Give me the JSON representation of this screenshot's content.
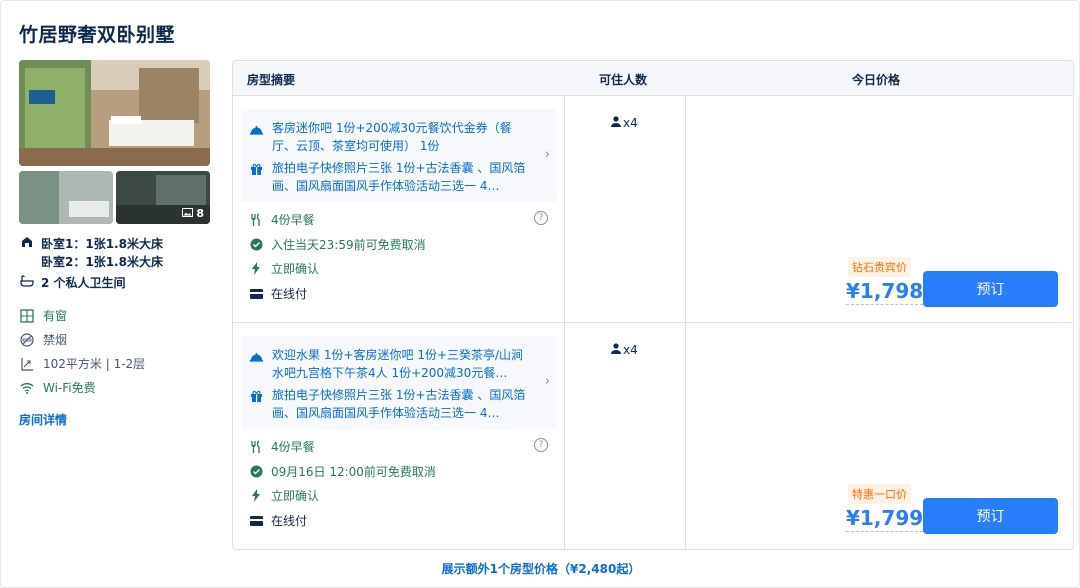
{
  "title": "竹居野奢双卧别墅",
  "photos": {
    "count": "8"
  },
  "beds": {
    "line1": "卧室1：1张1.8米大床",
    "line2": "卧室2：1张1.8米大床"
  },
  "bathroom": "2 个私人卫生间",
  "amenities": [
    {
      "label": "有窗",
      "icon": "window-icon"
    },
    {
      "label": "禁烟",
      "icon": "no-smoking-icon"
    },
    {
      "label": "102平方米 | 1-2层",
      "icon": "area-icon"
    },
    {
      "label": "Wi-Fi免费",
      "icon": "wifi-icon"
    }
  ],
  "room_detail_link": "房间详情",
  "table": {
    "headers": {
      "summary": "房型摘要",
      "occupancy": "可住人数",
      "price": "今日价格"
    },
    "rows": [
      {
        "package1": "客房迷你吧 1份+200减30元餐饮代金券（餐厅、云顶、茶室均可使用） 1份",
        "package2": "旅拍电子快修照片三张 1份+古法香囊 、国风箔画、国风扇面国风手作体验活动三选一 4…",
        "breakfast": "4份早餐",
        "cancel": "入住当天23:59前可免费取消",
        "confirm": "立即确认",
        "payment": "在线付",
        "occupancy": "x4",
        "price_tag": "钻石贵宾价",
        "price": "¥1,798",
        "book": "预订"
      },
      {
        "package1": "欢迎水果 1份+客房迷你吧 1份+三癸茶亭/山涧水吧九宫格下午茶4人 1份+200减30元餐…",
        "package2": "旅拍电子快修照片三张 1份+古法香囊 、国风箔画、国风扇面国风手作体验活动三选一 4…",
        "breakfast": "4份早餐",
        "cancel": "09月16日 12:00前可免费取消",
        "confirm": "立即确认",
        "payment": "在线付",
        "occupancy": "x4",
        "price_tag": "特惠一口价",
        "price": "¥1,799",
        "book": "预订"
      }
    ]
  },
  "more_link": "展示额外1个房型价格（¥2,480起）",
  "colors": {
    "accent": "#287dfa",
    "link": "#0b6cd1",
    "green": "#287a53",
    "orange": "#ff6f00"
  }
}
